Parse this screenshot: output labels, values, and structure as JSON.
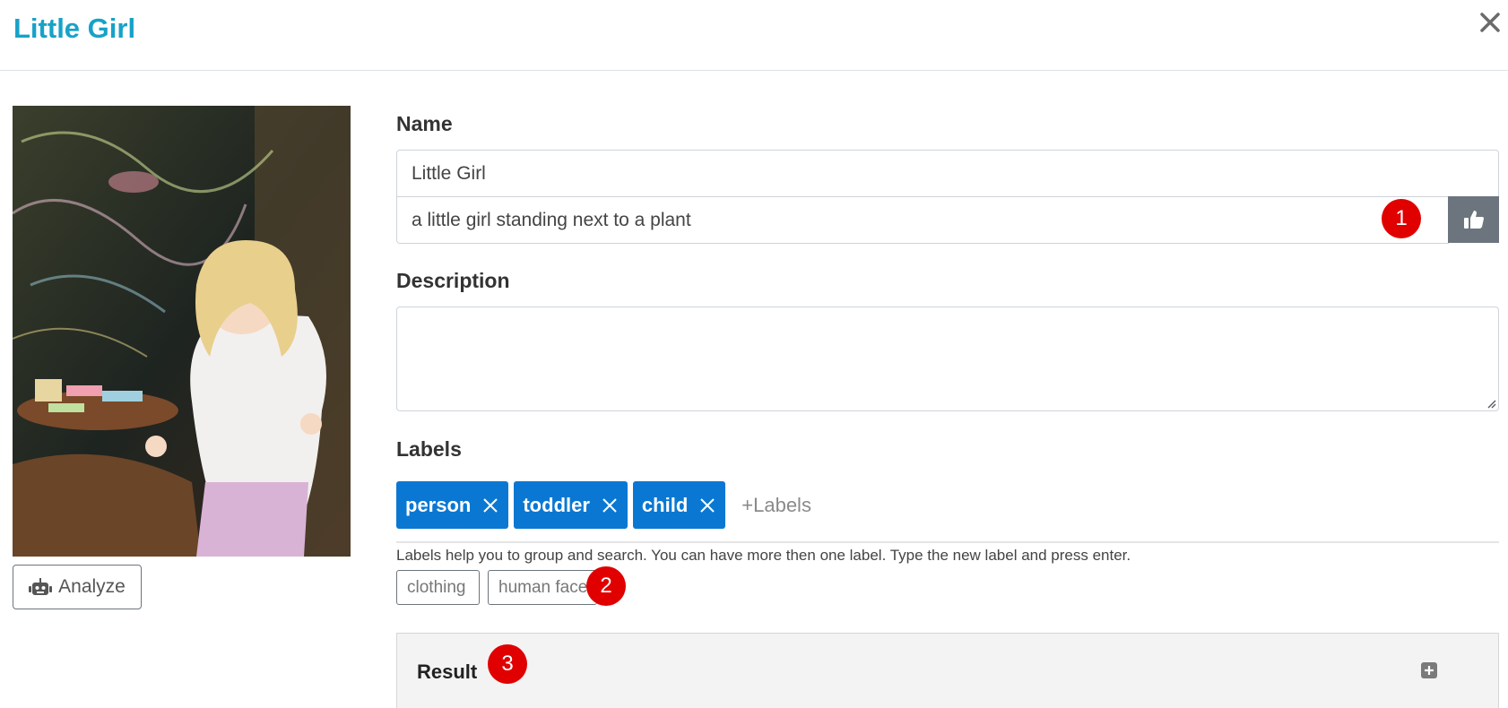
{
  "header": {
    "title": "Little Girl"
  },
  "analyze": {
    "label": "Analyze"
  },
  "form": {
    "name_label": "Name",
    "name_value": "Little Girl",
    "suggestion_value": "a little girl standing next to a plant",
    "description_label": "Description",
    "description_value": "",
    "labels_label": "Labels",
    "labels": [
      "person",
      "toddler",
      "child"
    ],
    "add_labels_placeholder": "+Labels",
    "labels_help": "Labels help you to group and search. You can have more then one label. Type the new label and press enter.",
    "suggested_labels": [
      "clothing",
      "human face"
    ]
  },
  "result": {
    "title": "Result"
  },
  "markers": [
    "1",
    "2",
    "3"
  ],
  "colors": {
    "accent": "#17a2c8",
    "tag": "#0a78d2",
    "marker": "#e00000",
    "button": "#6c757d"
  }
}
